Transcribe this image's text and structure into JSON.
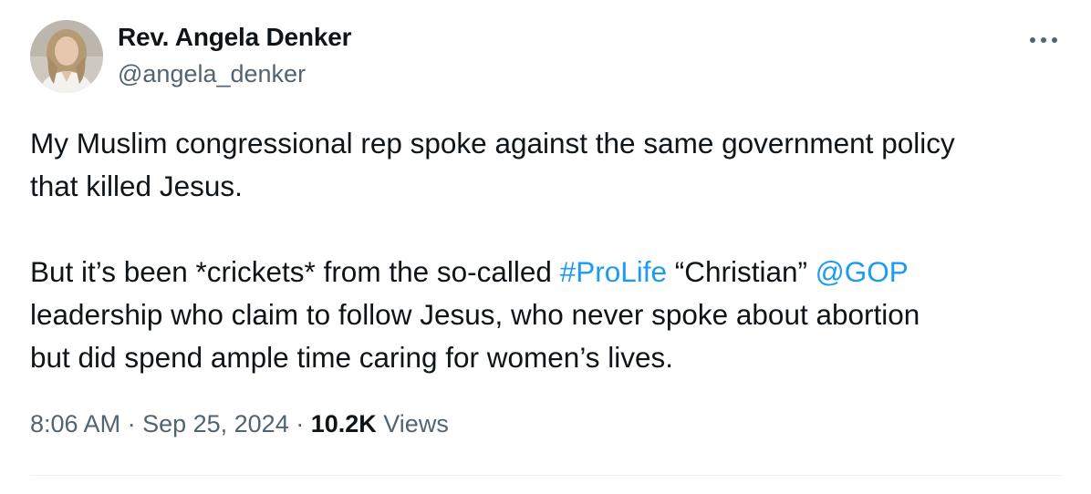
{
  "author": {
    "display_name": "Rev. Angela Denker",
    "handle": "@angela_denker"
  },
  "tweet": {
    "line1": "My Muslim congressional rep spoke against the same government policy",
    "line2": "that killed Jesus.",
    "line3_pre": "But it’s been *crickets* from the so-called ",
    "hashtag": "#ProLife",
    "line3_mid": " “Christian” ",
    "mention": "@GOP",
    "line4": "leadership who claim to follow Jesus, who never spoke about abortion",
    "line5": "but did spend ample time caring for women’s lives."
  },
  "meta": {
    "time": "8:06 AM",
    "separator1": " · ",
    "date": "Sep 25, 2024",
    "separator2": " · ",
    "views_count": "10.2K",
    "views_label": " Views"
  },
  "icons": {
    "more": "more-horizontal-icon"
  },
  "colors": {
    "link": "#1d9bf0",
    "secondary_text": "#536471",
    "primary_text": "#0f1419"
  }
}
